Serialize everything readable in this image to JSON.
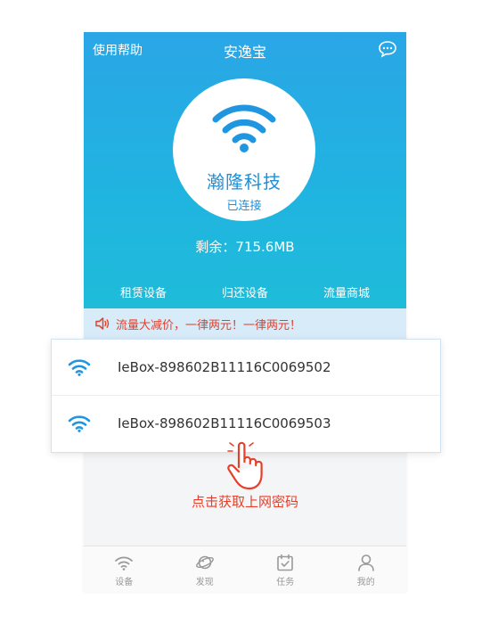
{
  "header": {
    "help_label": "使用帮助",
    "title": "安逸宝",
    "chat_icon": "chat-bubble-icon"
  },
  "connection": {
    "ssid": "瀚隆科技",
    "status": "已连接",
    "remaining_label": "剩余：",
    "remaining_value": "715.6MB"
  },
  "actions": [
    {
      "label": "租赁设备"
    },
    {
      "label": "归还设备"
    },
    {
      "label": "流量商城"
    }
  ],
  "notice": {
    "text": "流量大减价，一律两元！一律两元！",
    "icon": "speaker-icon"
  },
  "networks": [
    {
      "name": "IeBox-898602B11116C0069502",
      "icon": "wifi-icon"
    },
    {
      "name": "IeBox-898602B11116C0069503",
      "icon": "wifi-icon"
    }
  ],
  "hint": {
    "text": "点击获取上网密码",
    "icon": "pointing-hand-icon"
  },
  "tabs": [
    {
      "label": "设备",
      "icon": "wifi-icon"
    },
    {
      "label": "发现",
      "icon": "planet-icon"
    },
    {
      "label": "任务",
      "icon": "calendar-check-icon"
    },
    {
      "label": "我的",
      "icon": "user-icon"
    }
  ],
  "colors": {
    "primary_blue": "#2aa6e6",
    "accent_red": "#e5402b",
    "notice_bg": "#d8ebf8"
  }
}
